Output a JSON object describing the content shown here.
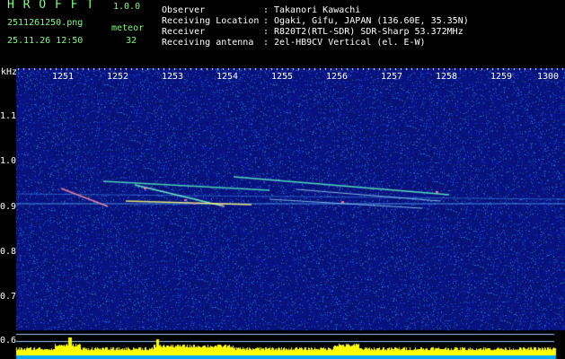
{
  "app": {
    "name": "H R O F F T",
    "version": "1.0.0"
  },
  "file": {
    "name": "2511261250.png",
    "timestamp": "25.11.26 12:50"
  },
  "count": {
    "label": "meteor",
    "value": "32"
  },
  "info": [
    {
      "key": "Observer",
      "sep": ":",
      "value": "Takanori Kawachi"
    },
    {
      "key": "Receiving Location",
      "sep": ":",
      "value": "Ogaki, Gifu, JAPAN (136.60E, 35.35N)"
    },
    {
      "key": "Receiver",
      "sep": ":",
      "value": "R820T2(RTL-SDR) SDR-Sharp 53.372MHz"
    },
    {
      "key": "Receiving antenna",
      "sep": ":",
      "value": "2el-HB9CV Vertical (el. E-W)"
    }
  ],
  "axis": {
    "unit": "kHz",
    "x_ticks": [
      "1251",
      "1252",
      "1253",
      "1254",
      "1255",
      "1256",
      "1257",
      "1258",
      "1259",
      "1300"
    ],
    "y_ticks": [
      "1.1",
      "1.0",
      "0.9",
      "0.8",
      "0.7",
      "0.6"
    ]
  },
  "colors": {
    "bg": "#000000",
    "header_green": "#7cff7c",
    "spectrum_base": "#0a1870",
    "level": "#ffff00"
  }
}
